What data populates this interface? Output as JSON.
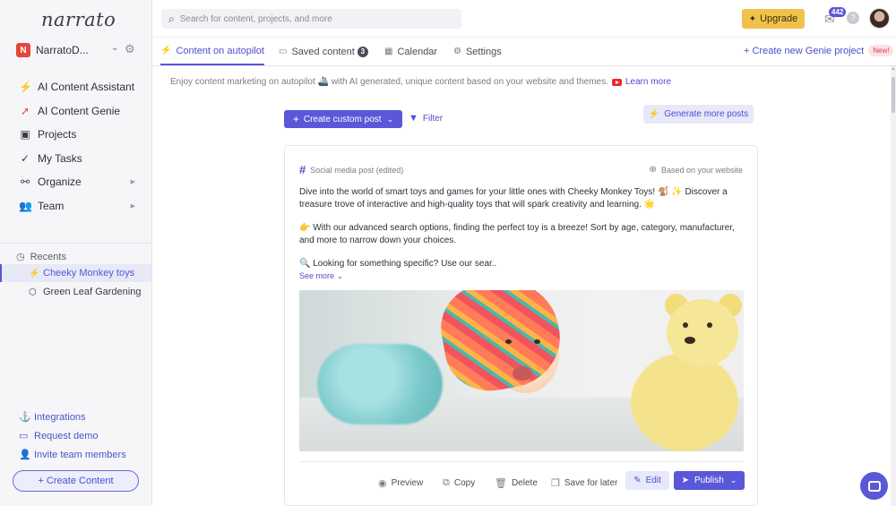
{
  "brand": {
    "logo": "narrato"
  },
  "workspace": {
    "initial": "N",
    "name": "NarratoD..."
  },
  "sidebar": {
    "items": [
      {
        "icon": "lightning-icon",
        "label": "AI Content Assistant"
      },
      {
        "icon": "rocket-icon",
        "label": "AI Content Genie"
      },
      {
        "icon": "briefcase-icon",
        "label": "Projects"
      },
      {
        "icon": "check-icon",
        "label": "My Tasks"
      },
      {
        "icon": "organize-icon",
        "label": "Organize"
      },
      {
        "icon": "team-icon",
        "label": "Team"
      }
    ],
    "recents_title": "Recents",
    "recents": [
      {
        "icon": "lightning-icon",
        "label": "Cheeky Monkey toys",
        "active": true
      },
      {
        "icon": "cube-icon",
        "label": "Green Leaf Gardening",
        "active": false
      }
    ],
    "bottom_links": [
      {
        "icon": "anchor-icon",
        "label": "Integrations"
      },
      {
        "icon": "monitor-icon",
        "label": "Request demo"
      },
      {
        "icon": "add-user-icon",
        "label": "Invite team members"
      }
    ],
    "create_label": "+ Create Content"
  },
  "header": {
    "search_placeholder": "Search for content, projects, and more",
    "upgrade_label": "Upgrade",
    "mail_count": "442",
    "help": "?"
  },
  "tabs": [
    {
      "label": "Content on autopilot",
      "active": true
    },
    {
      "label": "Saved content",
      "count": "3"
    },
    {
      "label": "Calendar"
    },
    {
      "label": "Settings"
    }
  ],
  "genie_link": {
    "label": "+ Create new Genie project",
    "badge": "New!"
  },
  "intro": {
    "text": "Enjoy content marketing on autopilot 🚢 with AI generated, unique content based on your website and themes.",
    "learn_more": "Learn more"
  },
  "toolbar": {
    "custom_post": "Create custom post",
    "filter": "Filter",
    "generate_more": "Generate more posts"
  },
  "post": {
    "type": "Social media post (edited)",
    "source": "Based on your website",
    "paragraphs": [
      "Dive into the world of smart toys and games for your little ones with Cheeky Monkey Toys! 🐒 ✨ Discover a treasure trove of interactive and high-quality toys that will spark creativity and learning. 🌟",
      "👉 With our advanced search options, finding the perfect toy is a breeze! Sort by age, category, manufacturer, and more to narrow down your choices.",
      "🔍 Looking for something specific? Use our sear.."
    ],
    "see_more": "See more",
    "actions": {
      "preview": "Preview",
      "copy": "Copy",
      "delete": "Delete",
      "save": "Save for later",
      "edit": "Edit",
      "publish": "Publish"
    }
  },
  "colors": {
    "accent": "#5a58d8",
    "upgrade": "#f0c24b",
    "workspace": "#e4463b"
  }
}
